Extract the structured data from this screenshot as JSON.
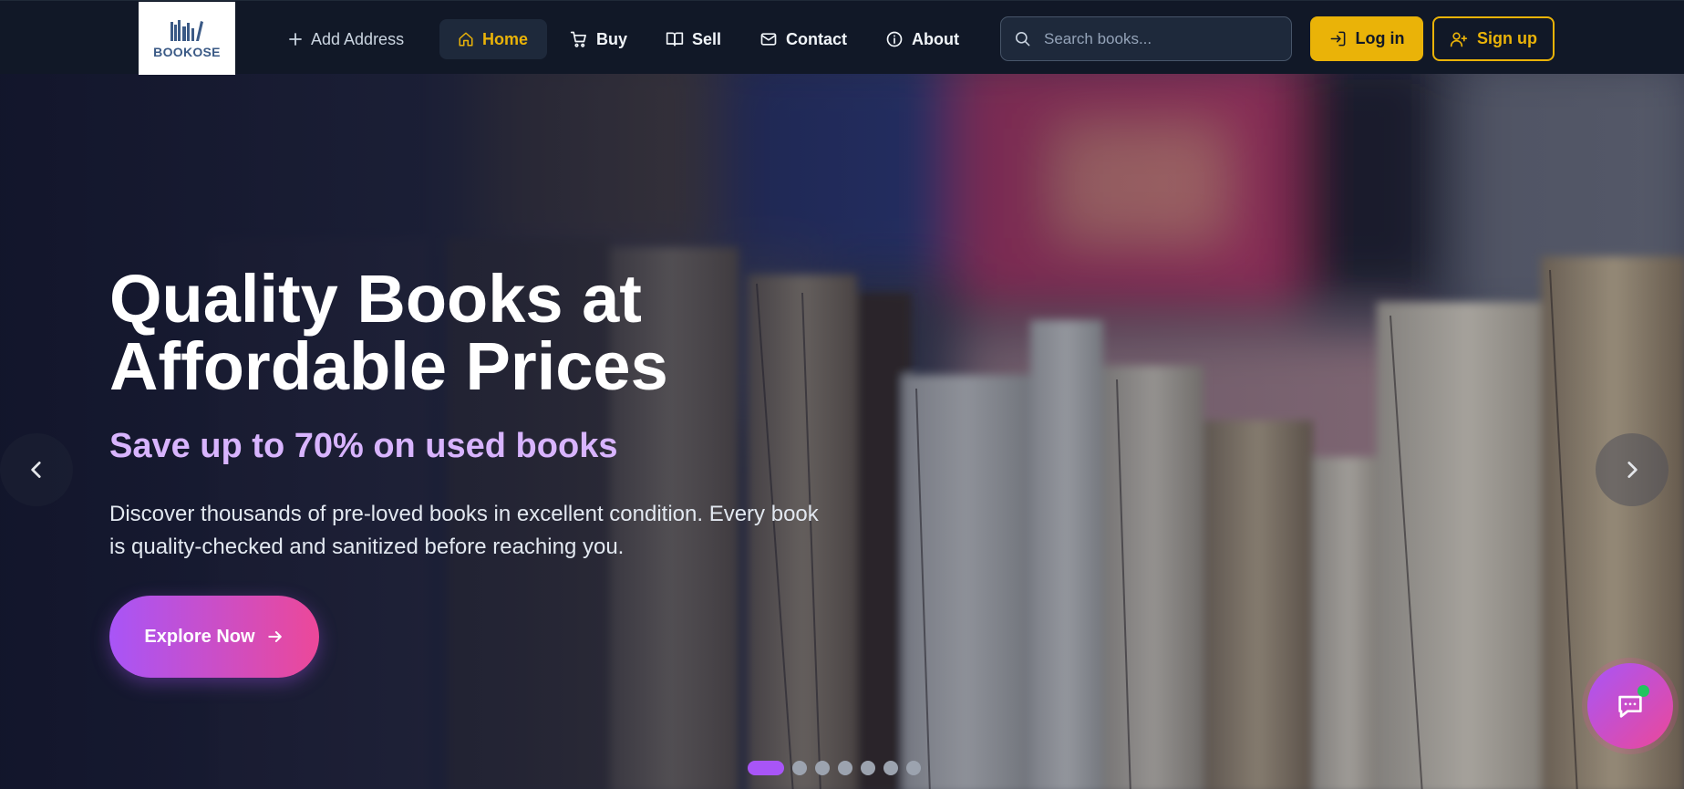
{
  "brand": {
    "logo_text": "BOOKOSE"
  },
  "nav": {
    "add_address": "Add Address",
    "home": "Home",
    "buy": "Buy",
    "sell": "Sell",
    "contact": "Contact",
    "about": "About",
    "active": "Home"
  },
  "search": {
    "placeholder": "Search books...",
    "value": ""
  },
  "auth": {
    "login": "Log in",
    "signup": "Sign up"
  },
  "hero": {
    "title_line1": "Quality Books at",
    "title_line2": "Affordable Prices",
    "subtitle": "Save up to 70% on used books",
    "description": "Discover thousands of pre-loved books in excellent condition. Every book is quality-checked and sanitized before reaching you.",
    "cta": "Explore Now"
  },
  "carousel": {
    "slide_count": 7,
    "active_index": 0
  },
  "colors": {
    "accent_yellow": "#eab308",
    "navbar_bg": "#111827",
    "purple": "#a855f7",
    "pink": "#ec4899",
    "subtitle_lavender": "#d8b4fe",
    "online_green": "#22c55e"
  },
  "icons": {
    "add": "plus-icon",
    "home": "home-icon",
    "buy": "cart-icon",
    "sell": "book-open-icon",
    "contact": "mail-icon",
    "about": "info-icon",
    "search": "search-icon",
    "login": "login-icon",
    "signup": "user-plus-icon",
    "explore": "arrow-right-icon",
    "prev": "chevron-left-icon",
    "next": "chevron-right-icon",
    "chat": "chat-bubble-icon"
  }
}
